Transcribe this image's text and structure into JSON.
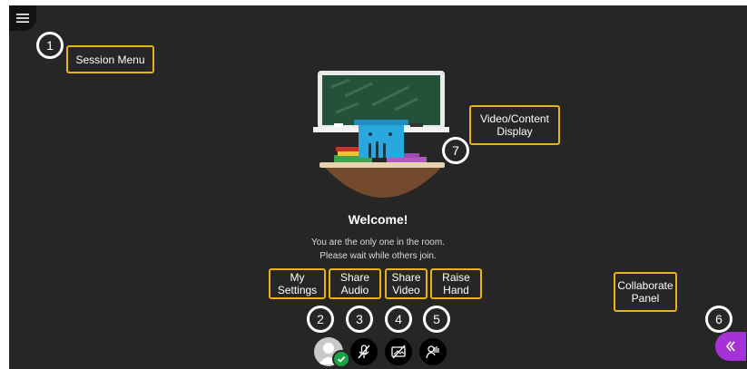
{
  "callouts": {
    "session_menu": "Session Menu",
    "video_content_line1": "Video/Content",
    "video_content_line2": "Display",
    "collaborate_line1": "Collaborate",
    "collaborate_line2": "Panel",
    "my_settings_line1": "My",
    "my_settings_line2": "Settings",
    "share_audio_line1": "Share",
    "share_audio_line2": "Audio",
    "share_video_line1": "Share",
    "share_video_line2": "Video",
    "raise_hand_line1": "Raise",
    "raise_hand_line2": "Hand"
  },
  "markers": {
    "m1": "1",
    "m2": "2",
    "m3": "3",
    "m4": "4",
    "m5": "5",
    "m6": "6",
    "m7": "7"
  },
  "welcome": {
    "title": "Welcome!",
    "line1": "You are the only one in the room.",
    "line2": "Please wait while others join."
  },
  "icons": {
    "menu": "hamburger-menu-icon",
    "avatar": "user-avatar-icon",
    "status": "check-icon",
    "audio": "microphone-muted-icon",
    "video": "camera-off-icon",
    "hand": "raise-hand-icon",
    "panel": "double-chevron-left-icon"
  },
  "colors": {
    "background": "#262626",
    "callout_border": "#e8b415",
    "collaborate_accent": "#a532d6",
    "status_green": "#1ca34a"
  }
}
